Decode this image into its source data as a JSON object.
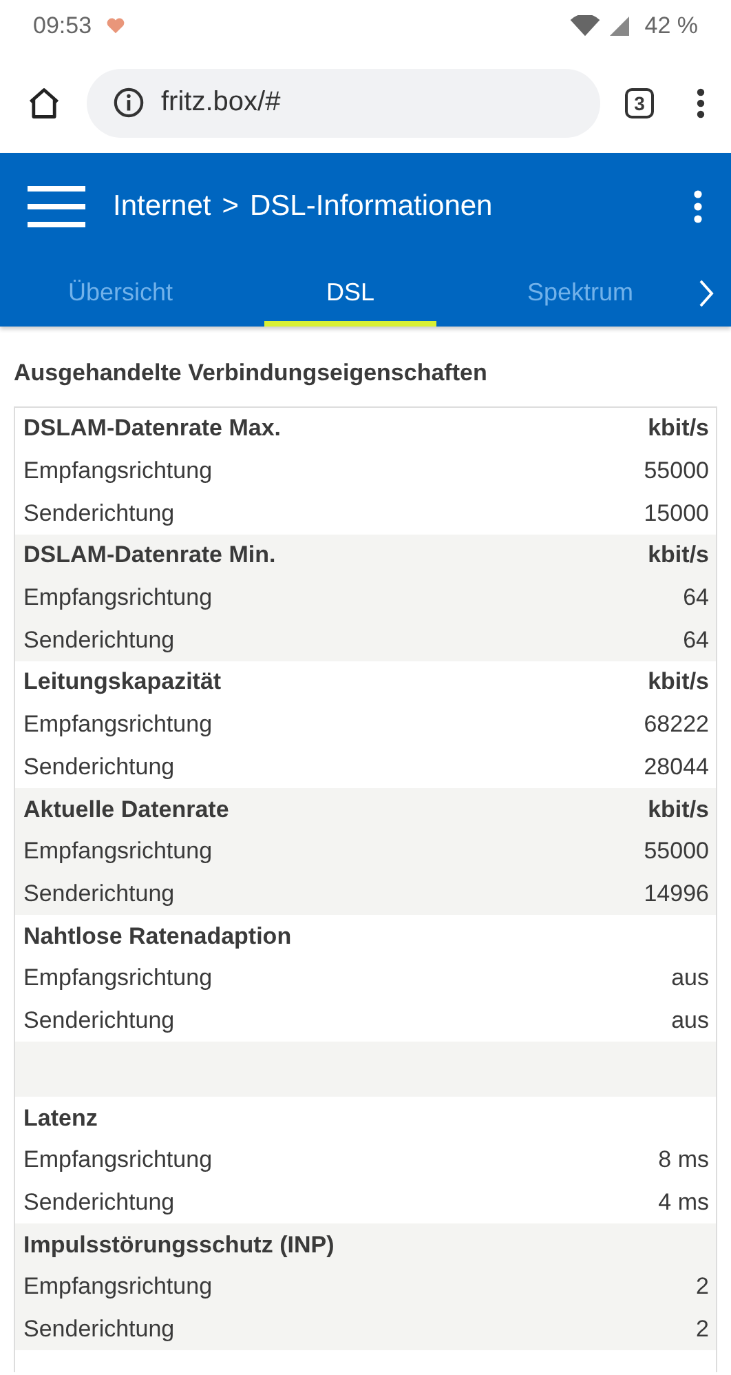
{
  "status_bar": {
    "time": "09:53",
    "battery": "42 %"
  },
  "browser": {
    "url": "fritz.box/#",
    "tab_count": "3"
  },
  "header": {
    "breadcrumb_parent": "Internet",
    "breadcrumb_separator": ">",
    "title": "DSL-Informationen"
  },
  "tabs": [
    {
      "label": "Übersicht",
      "selected": false
    },
    {
      "label": "DSL",
      "selected": true
    },
    {
      "label": "Spektrum",
      "selected": false
    }
  ],
  "section_title": "Ausgehandelte Verbindungseigenschaften",
  "groups": [
    {
      "kind": "group",
      "title": "DSLAM-Datenrate Max.",
      "unit": "kbit/s",
      "rows": [
        {
          "label": "Empfangsrichtung",
          "value": "55000"
        },
        {
          "label": "Senderichtung",
          "value": "15000"
        }
      ]
    },
    {
      "kind": "group",
      "title": "DSLAM-Datenrate Min.",
      "unit": "kbit/s",
      "rows": [
        {
          "label": "Empfangsrichtung",
          "value": "64"
        },
        {
          "label": "Senderichtung",
          "value": "64"
        }
      ]
    },
    {
      "kind": "group",
      "title": "Leitungskapazität",
      "unit": "kbit/s",
      "rows": [
        {
          "label": "Empfangsrichtung",
          "value": "68222"
        },
        {
          "label": "Senderichtung",
          "value": "28044"
        }
      ]
    },
    {
      "kind": "group",
      "title": "Aktuelle Datenrate",
      "unit": "kbit/s",
      "rows": [
        {
          "label": "Empfangsrichtung",
          "value": "55000"
        },
        {
          "label": "Senderichtung",
          "value": "14996"
        }
      ]
    },
    {
      "kind": "group",
      "title": "Nahtlose Ratenadaption",
      "rows": [
        {
          "label": "Empfangsrichtung",
          "value": "aus"
        },
        {
          "label": "Senderichtung",
          "value": "aus"
        }
      ]
    },
    {
      "kind": "spacer"
    },
    {
      "kind": "group",
      "title": "Latenz",
      "rows": [
        {
          "label": "Empfangsrichtung",
          "value": "8 ms"
        },
        {
          "label": "Senderichtung",
          "value": "4 ms"
        }
      ]
    },
    {
      "kind": "group",
      "title": "Impulsstörungsschutz (INP)",
      "rows": [
        {
          "label": "Empfangsrichtung",
          "value": "2"
        },
        {
          "label": "Senderichtung",
          "value": "2"
        }
      ]
    }
  ]
}
